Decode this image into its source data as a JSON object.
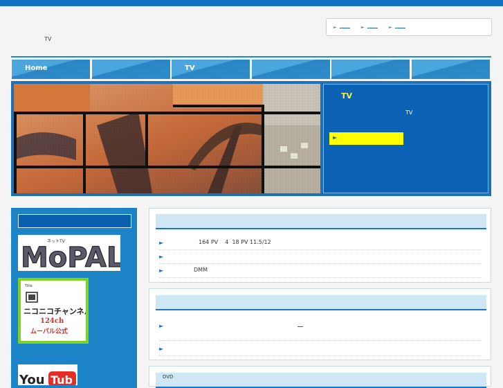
{
  "header": {
    "top_links": [
      "",
      "",
      ""
    ],
    "tagline": "TV"
  },
  "nav": {
    "tabs": [
      "Home",
      "",
      "TV",
      "",
      "",
      ""
    ]
  },
  "hero": {
    "title": "TV",
    "subtitle": "TV",
    "button_label": ""
  },
  "sidebar": {
    "heading": "",
    "banners": [
      "MoPAL",
      "ニコニコチャンネル 124ch ムーパル公式",
      "YouTube"
    ]
  },
  "panels": [
    {
      "heading": "",
      "items": [
        "164 PV    4  18 PV 11.5/12",
        "",
        "DMM"
      ]
    },
    {
      "heading": "",
      "items": [
        "",
        ""
      ]
    },
    {
      "heading": "DVD"
    }
  ],
  "colors": {
    "brand_blue": "#1273c4",
    "hero_panel": "#0c62b4",
    "accent_yellow": "#ffff00",
    "title_yellow": "#ffef3a",
    "niconico_green": "#7ed321"
  }
}
